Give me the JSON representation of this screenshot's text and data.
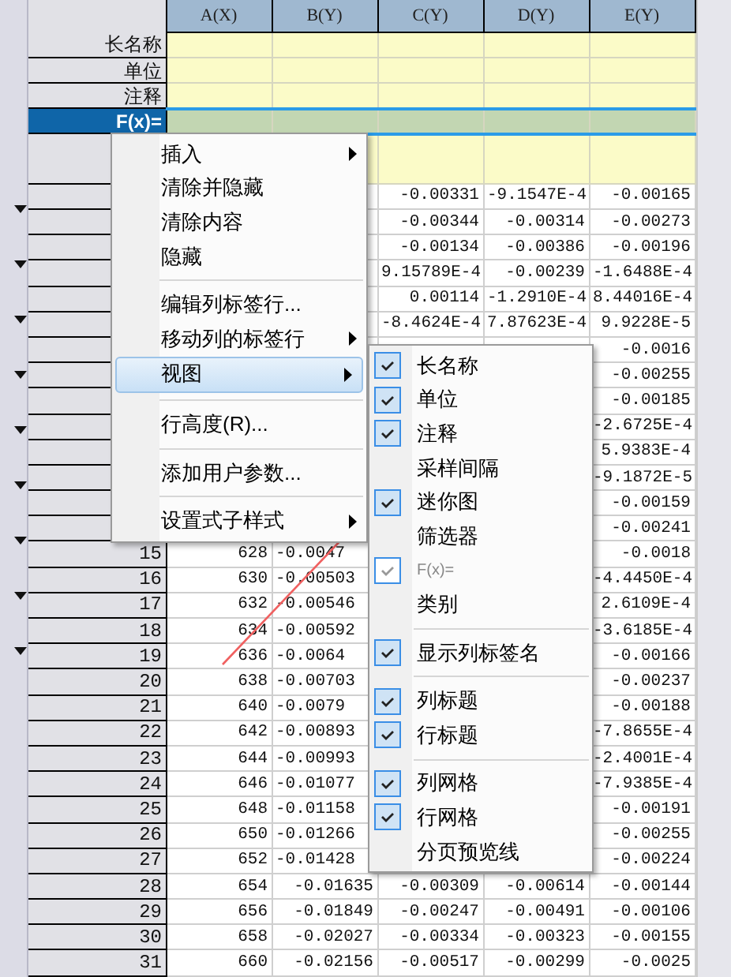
{
  "columns": [
    "A(X)",
    "B(Y)",
    "C(Y)",
    "D(Y)",
    "E(Y)"
  ],
  "label_rows": [
    {
      "label": "长名称",
      "selected": false
    },
    {
      "label": "单位",
      "selected": false
    },
    {
      "label": "注释",
      "selected": false
    },
    {
      "label": "F(x)=",
      "selected": true
    },
    {
      "selected": false
    }
  ],
  "rows": [
    {
      "cells": [
        null,
        null,
        "-0.00331",
        "-9.1547E-4",
        "-0.00165"
      ]
    },
    {
      "cells": [
        null,
        null,
        "-0.00344",
        "-0.00314",
        "-0.00273"
      ]
    },
    {
      "cells": [
        null,
        null,
        "-0.00134",
        "-0.00386",
        "-0.00196"
      ]
    },
    {
      "cells": [
        null,
        null,
        "9.15789E-4",
        "-0.00239",
        "-1.6488E-4"
      ]
    },
    {
      "cells": [
        null,
        null,
        "0.00114",
        "-1.2910E-4",
        "8.44016E-4"
      ]
    },
    {
      "cells": [
        null,
        null,
        "-8.4624E-4",
        "7.87623E-4",
        "9.9228E-5"
      ]
    },
    {
      "cells": [
        null,
        null,
        null,
        null,
        "-0.0016"
      ]
    },
    {
      "cells": [
        null,
        null,
        null,
        null,
        "-0.00255"
      ]
    },
    {
      "cells": [
        null,
        null,
        null,
        null,
        "-0.00185"
      ]
    },
    {
      "cells": [
        null,
        null,
        null,
        null,
        "-2.6725E-4"
      ]
    },
    {
      "cells": [
        null,
        null,
        null,
        null,
        "5.9383E-4"
      ]
    },
    {
      "cells": [
        null,
        null,
        null,
        null,
        "-9.1872E-5"
      ]
    },
    {
      "cells": [
        null,
        null,
        null,
        null,
        "-0.00159"
      ]
    },
    {
      "cells": [
        null,
        null,
        null,
        null,
        "-0.00241"
      ]
    },
    {
      "row": "15",
      "cells": [
        "628",
        "-0.0047",
        null,
        null,
        "-0.0018"
      ]
    },
    {
      "row": "16",
      "cells": [
        "630",
        "-0.00503",
        null,
        null,
        "-4.4450E-4"
      ]
    },
    {
      "row": "17",
      "cells": [
        "632",
        "-0.00546",
        null,
        null,
        "2.6109E-4"
      ]
    },
    {
      "row": "18",
      "cells": [
        "634",
        "-0.00592",
        null,
        null,
        "-3.6185E-4"
      ]
    },
    {
      "row": "19",
      "cells": [
        "636",
        "-0.0064",
        null,
        null,
        "-0.00166"
      ]
    },
    {
      "row": "20",
      "cells": [
        "638",
        "-0.00703",
        null,
        null,
        "-0.00237"
      ]
    },
    {
      "row": "21",
      "cells": [
        "640",
        "-0.0079",
        null,
        null,
        "-0.00188"
      ]
    },
    {
      "row": "22",
      "cells": [
        "642",
        "-0.00893",
        null,
        null,
        "-7.8655E-4"
      ]
    },
    {
      "row": "23",
      "cells": [
        "644",
        "-0.00993",
        null,
        null,
        "-2.4001E-4"
      ]
    },
    {
      "row": "24",
      "cells": [
        "646",
        "-0.01077",
        null,
        null,
        "-7.9385E-4"
      ]
    },
    {
      "row": "25",
      "cells": [
        "648",
        "-0.01158",
        null,
        null,
        "-0.00191"
      ]
    },
    {
      "row": "26",
      "cells": [
        "650",
        "-0.01266",
        null,
        null,
        "-0.00255"
      ]
    },
    {
      "row": "27",
      "cells": [
        "652",
        "-0.01428",
        null,
        null,
        "-0.00224"
      ]
    },
    {
      "row": "28",
      "cells": [
        "654",
        "-0.01635",
        "-0.00309",
        "-0.00614",
        "-0.00144"
      ]
    },
    {
      "row": "29",
      "cells": [
        "656",
        "-0.01849",
        "-0.00247",
        "-0.00491",
        "-0.00106"
      ]
    },
    {
      "row": "30",
      "cells": [
        "658",
        "-0.02027",
        "-0.00334",
        "-0.00323",
        "-0.00155"
      ]
    },
    {
      "row": "31",
      "cells": [
        "660",
        "-0.02156",
        "-0.00517",
        "-0.00299",
        "-0.0025"
      ]
    }
  ],
  "context_menu": {
    "items": [
      {
        "kind": "item",
        "label": "插入",
        "submenu": true,
        "selected": false
      },
      {
        "kind": "item",
        "label": "清除并隐藏",
        "submenu": false,
        "selected": false
      },
      {
        "kind": "item",
        "label": "清除内容",
        "submenu": false,
        "selected": false
      },
      {
        "kind": "item",
        "label": "隐藏",
        "submenu": false,
        "selected": false
      },
      {
        "kind": "separator"
      },
      {
        "kind": "item",
        "label": "编辑列标签行...",
        "submenu": false,
        "selected": false
      },
      {
        "kind": "item",
        "label": "移动列的标签行",
        "submenu": true,
        "selected": false
      },
      {
        "kind": "item",
        "label": "视图",
        "submenu": true,
        "selected": true
      },
      {
        "kind": "separator"
      },
      {
        "kind": "item",
        "label": "行高度(R)...",
        "submenu": false,
        "selected": false
      },
      {
        "kind": "separator"
      },
      {
        "kind": "item",
        "label": "添加用户参数...",
        "submenu": false,
        "selected": false
      },
      {
        "kind": "separator"
      },
      {
        "kind": "item",
        "label": "设置式子样式",
        "submenu": true,
        "selected": false
      }
    ]
  },
  "view_submenu": {
    "items": [
      {
        "kind": "item",
        "label": "长名称",
        "checked": true,
        "disabled": false
      },
      {
        "kind": "item",
        "label": "单位",
        "checked": true,
        "disabled": false
      },
      {
        "kind": "item",
        "label": "注释",
        "checked": true,
        "disabled": false
      },
      {
        "kind": "item",
        "label": "采样间隔",
        "checked": false,
        "disabled": false
      },
      {
        "kind": "item",
        "label": "迷你图",
        "checked": true,
        "disabled": false
      },
      {
        "kind": "item",
        "label": "筛选器",
        "checked": false,
        "disabled": false
      },
      {
        "kind": "item",
        "label": "F(x)=",
        "checked": true,
        "disabled": true
      },
      {
        "kind": "item",
        "label": "类别",
        "checked": false,
        "disabled": false
      },
      {
        "kind": "separator"
      },
      {
        "kind": "item",
        "label": "显示列标签名",
        "checked": true,
        "disabled": false
      },
      {
        "kind": "separator"
      },
      {
        "kind": "item",
        "label": "列标题",
        "checked": true,
        "disabled": false
      },
      {
        "kind": "item",
        "label": "行标题",
        "checked": true,
        "disabled": false
      },
      {
        "kind": "separator"
      },
      {
        "kind": "item",
        "label": "列网格",
        "checked": true,
        "disabled": false
      },
      {
        "kind": "item",
        "label": "行网格",
        "checked": true,
        "disabled": false
      },
      {
        "kind": "item",
        "label": "分页预览线",
        "checked": false,
        "disabled": false
      }
    ]
  }
}
